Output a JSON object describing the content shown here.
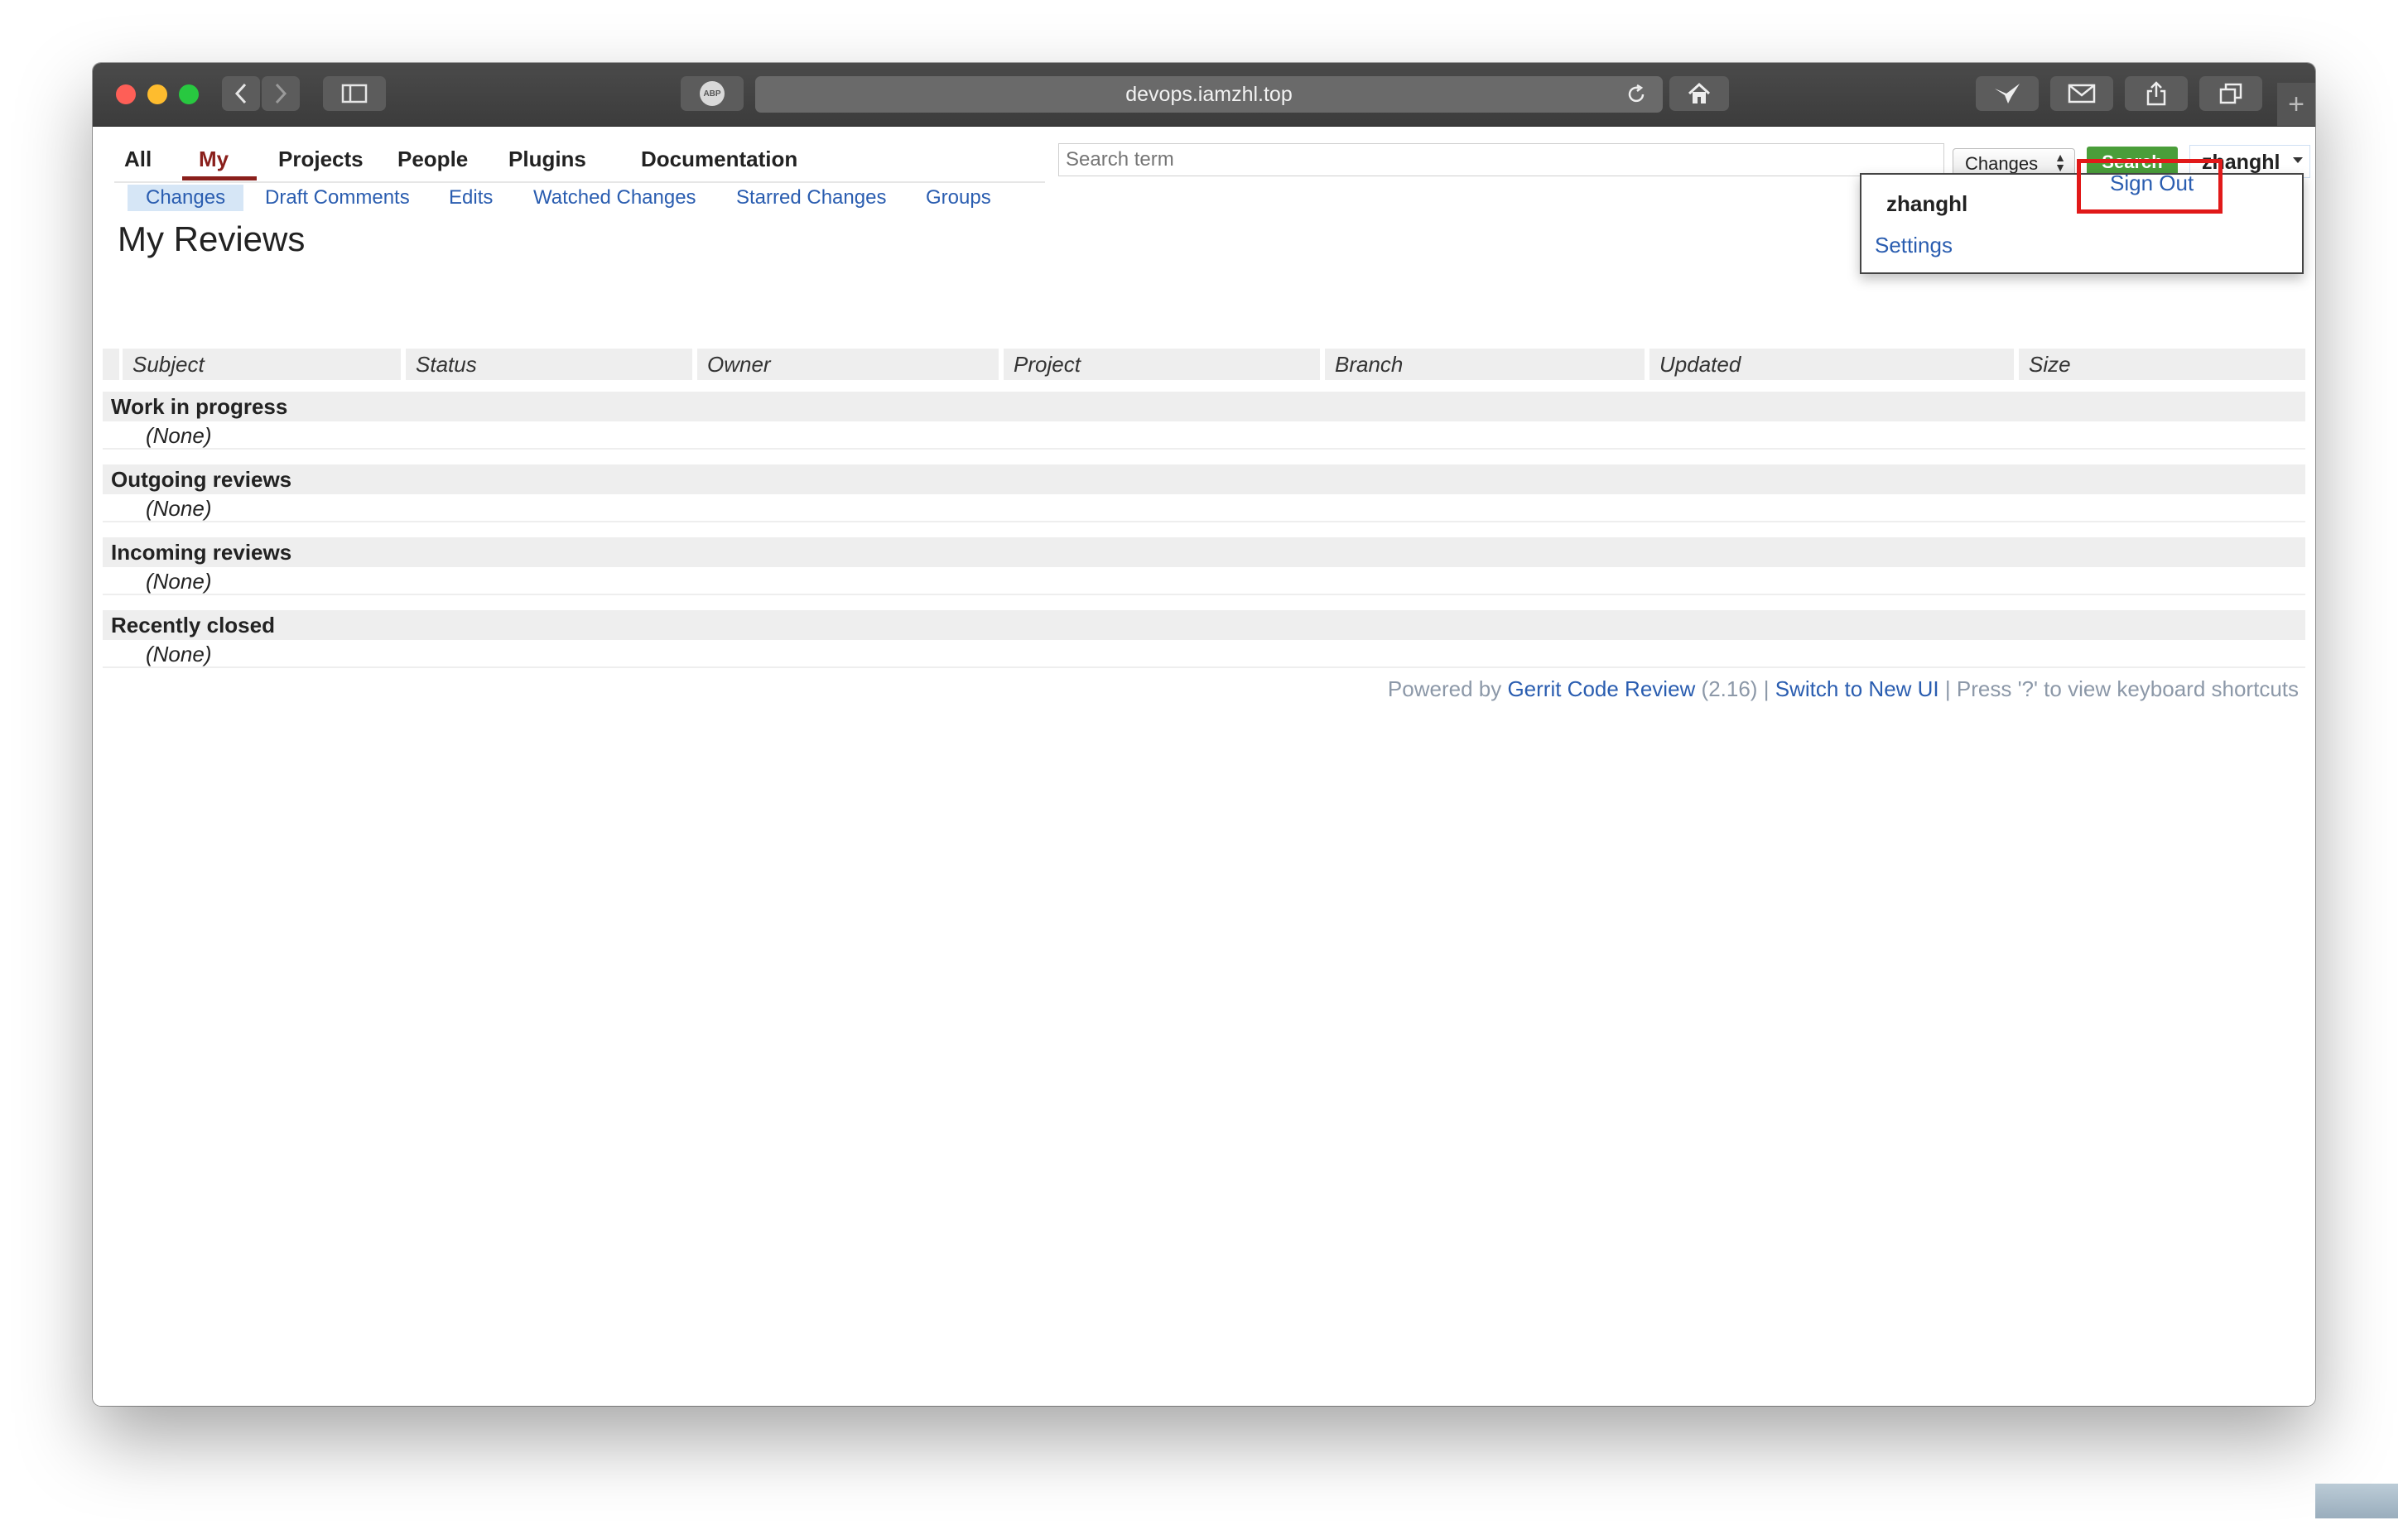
{
  "browser": {
    "url": "devops.iamzhl.top",
    "abp_label": "ABP"
  },
  "nav": {
    "top": [
      "All",
      "My",
      "Projects",
      "People",
      "Plugins",
      "Documentation"
    ],
    "active": "My",
    "sub": [
      "Changes",
      "Draft Comments",
      "Edits",
      "Watched Changes",
      "Starred Changes",
      "Groups"
    ],
    "sub_selected": "Changes"
  },
  "page_title": "My Reviews",
  "search": {
    "placeholder": "Search term",
    "scope": "Changes",
    "button": "Search"
  },
  "user": {
    "name": "zhanghl",
    "menu_name": "zhanghl",
    "settings": "Settings",
    "sign_out": "Sign Out"
  },
  "table": {
    "columns": [
      "Subject",
      "Status",
      "Owner",
      "Project",
      "Branch",
      "Updated",
      "Size"
    ],
    "sections": [
      {
        "title": "Work in progress",
        "empty": "(None)"
      },
      {
        "title": "Outgoing reviews",
        "empty": "(None)"
      },
      {
        "title": "Incoming reviews",
        "empty": "(None)"
      },
      {
        "title": "Recently closed",
        "empty": "(None)"
      }
    ]
  },
  "footer": {
    "powered_by": "Powered by",
    "gerrit_link": "Gerrit Code Review",
    "version": "(2.16)",
    "sep": "|",
    "new_ui": "Switch to New UI",
    "shortcuts": "Press '?' to view keyboard shortcuts"
  },
  "colors": {
    "accent": "#8a1f1b",
    "link": "#2a5db0",
    "search_button": "#4a9e3a",
    "highlight": "#e11919"
  }
}
